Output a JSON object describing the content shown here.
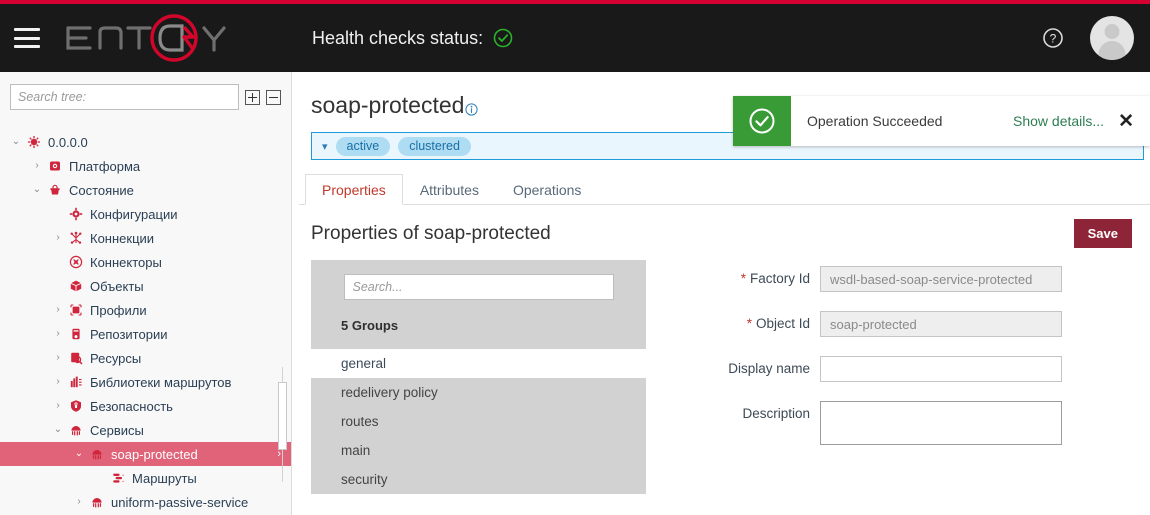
{
  "colors": {
    "accent_red": "#d50032",
    "header_bg": "#191919",
    "selected_tree": "#e06379",
    "save_button": "#8e2437",
    "toast_green": "#389b36",
    "info_blue": "#1f9ad6",
    "groups_panel": "#d2d2d2"
  },
  "header": {
    "menu_icon": "hamburger-menu-icon",
    "logo_text": "ENTAXY",
    "health_label": "Health checks status:",
    "health_status_icon": "check-circle-green-icon",
    "help_icon": "help-question-icon",
    "avatar_icon": "user-avatar-icon"
  },
  "sidebar": {
    "search": {
      "placeholder": "Search tree:",
      "value": ""
    },
    "expand_all_label": "+",
    "collapse_all_label": "−",
    "tree": [
      {
        "label": "0.0.0.0",
        "depth": 0,
        "twisty": "⌄",
        "icon": "server-root-icon",
        "selected": false
      },
      {
        "label": "Платформа",
        "depth": 1,
        "twisty": "›",
        "icon": "platform-icon",
        "selected": false
      },
      {
        "label": "Состояние",
        "depth": 1,
        "twisty": "⌄",
        "icon": "state-icon",
        "selected": false
      },
      {
        "label": "Конфигурации",
        "depth": 2,
        "twisty": "",
        "icon": "configurations-icon",
        "selected": false
      },
      {
        "label": "Коннекции",
        "depth": 2,
        "twisty": "›",
        "icon": "connections-icon",
        "selected": false
      },
      {
        "label": "Коннекторы",
        "depth": 2,
        "twisty": "",
        "icon": "connectors-icon",
        "selected": false
      },
      {
        "label": "Объекты",
        "depth": 2,
        "twisty": "",
        "icon": "objects-icon",
        "selected": false
      },
      {
        "label": "Профили",
        "depth": 2,
        "twisty": "›",
        "icon": "profiles-icon",
        "selected": false
      },
      {
        "label": "Репозитории",
        "depth": 2,
        "twisty": "›",
        "icon": "repositories-icon",
        "selected": false
      },
      {
        "label": "Ресурсы",
        "depth": 2,
        "twisty": "›",
        "icon": "resources-icon",
        "selected": false
      },
      {
        "label": "Библиотеки маршрутов",
        "depth": 2,
        "twisty": "›",
        "icon": "route-libraries-icon",
        "selected": false
      },
      {
        "label": "Безопасность",
        "depth": 2,
        "twisty": "›",
        "icon": "security-shield-icon",
        "selected": false
      },
      {
        "label": "Сервисы",
        "depth": 2,
        "twisty": "⌄",
        "icon": "services-icon",
        "selected": false
      },
      {
        "label": "soap-protected",
        "depth": 3,
        "twisty": "⌄",
        "icon": "service-icon",
        "selected": true
      },
      {
        "label": "Маршруты",
        "depth": 4,
        "twisty": "",
        "icon": "routes-icon",
        "selected": false
      },
      {
        "label": "uniform-passive-service",
        "depth": 3,
        "twisty": "›",
        "icon": "service-icon",
        "selected": false
      }
    ]
  },
  "main": {
    "page_title": "soap-protected",
    "page_title_info_icon": "info-circle-icon",
    "status_caret_icon": "chevron-down-icon",
    "status_badges": [
      "active",
      "clustered"
    ],
    "tabs": [
      {
        "label": "Properties",
        "active": true
      },
      {
        "label": "Attributes",
        "active": false
      },
      {
        "label": "Operations",
        "active": false
      }
    ],
    "properties_title": "Properties of soap-protected",
    "save_label": "Save",
    "groups": {
      "search_placeholder": "Search...",
      "search_value": "",
      "count_label": "5 Groups",
      "items": [
        {
          "label": "general",
          "active": true
        },
        {
          "label": "redelivery policy",
          "active": false
        },
        {
          "label": "routes",
          "active": false
        },
        {
          "label": "main",
          "active": false
        },
        {
          "label": "security",
          "active": false
        }
      ]
    },
    "form": [
      {
        "label": "Factory Id",
        "required": true,
        "value": "wsdl-based-soap-service-protected",
        "disabled": true,
        "type": "input"
      },
      {
        "label": "Object Id",
        "required": true,
        "value": "soap-protected",
        "disabled": true,
        "type": "input"
      },
      {
        "label": "Display name",
        "required": false,
        "value": "",
        "disabled": false,
        "type": "input"
      },
      {
        "label": "Description",
        "required": false,
        "value": "",
        "disabled": false,
        "type": "textarea"
      }
    ]
  },
  "toast": {
    "icon": "check-circle-white-icon",
    "message": "Operation Succeeded",
    "details_label": "Show details...",
    "close_label": "✕"
  }
}
